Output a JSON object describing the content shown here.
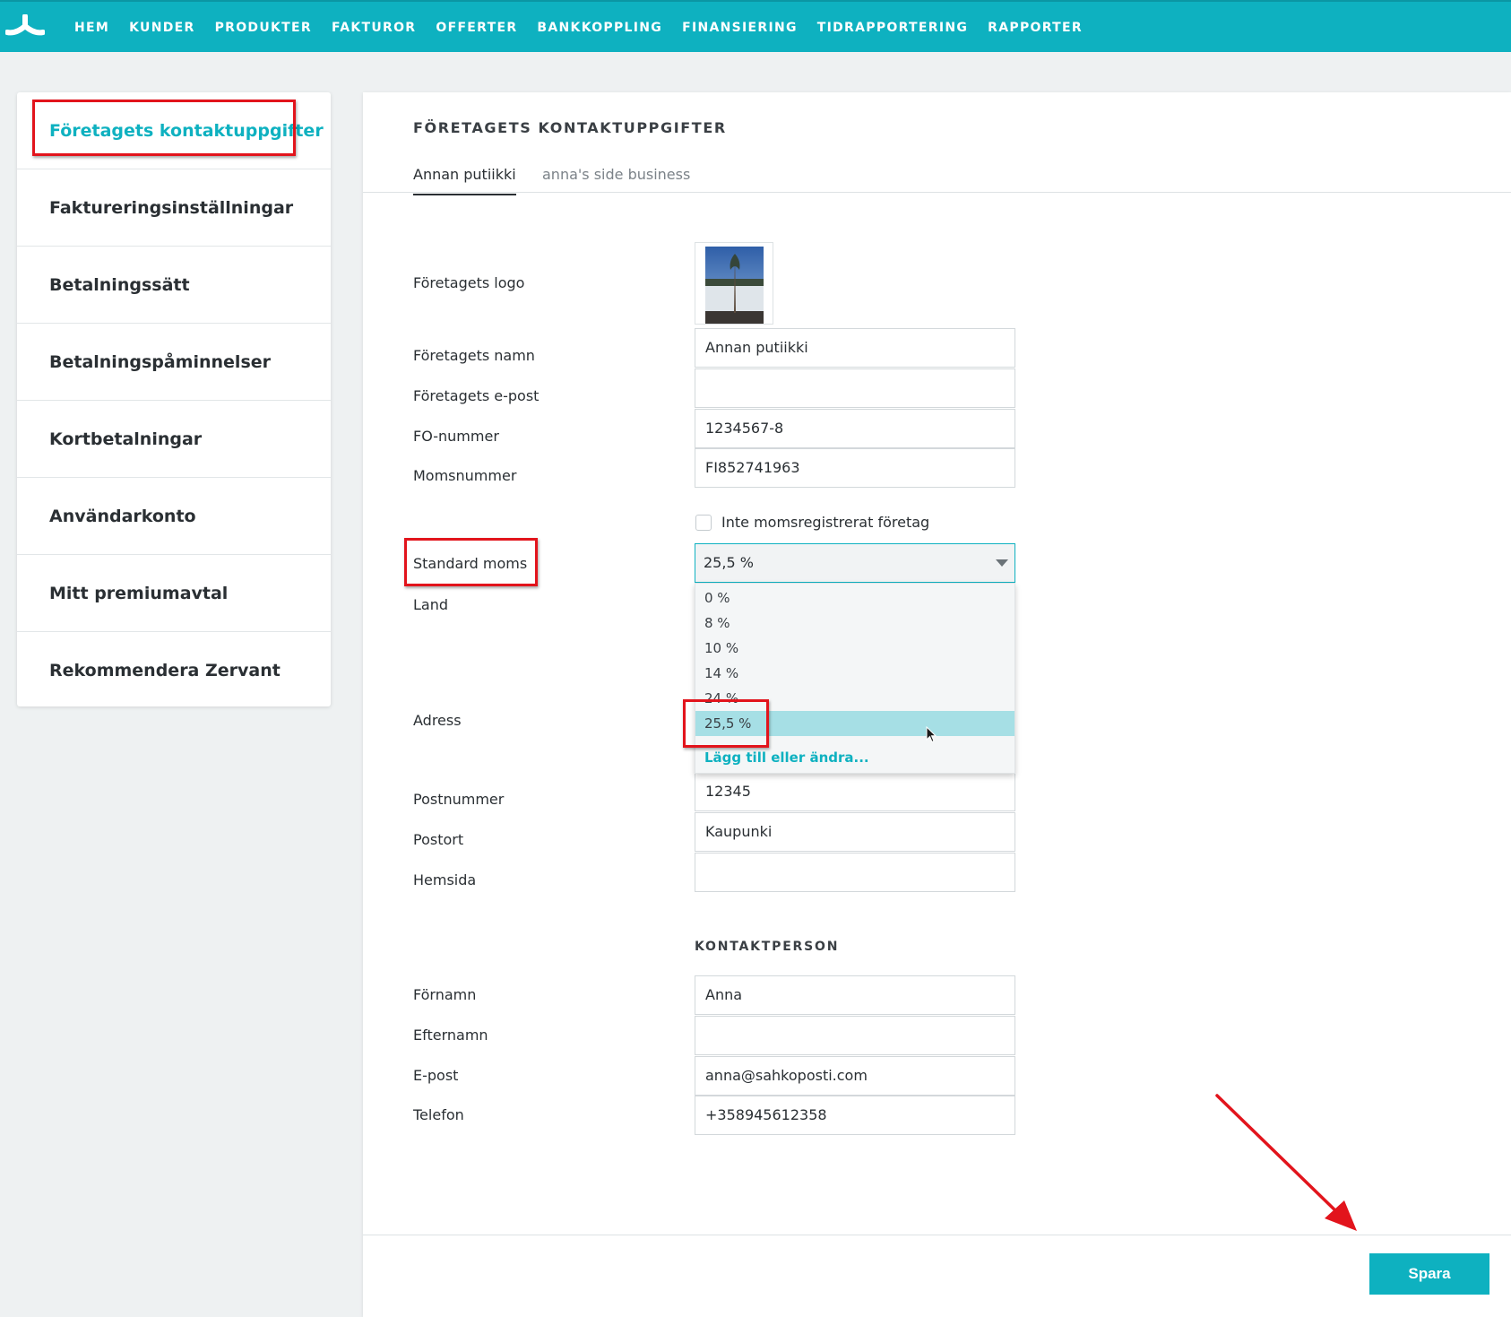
{
  "nav": {
    "items": [
      "HEM",
      "KUNDER",
      "PRODUKTER",
      "FAKTUROR",
      "OFFERTER",
      "BANKKOPPLING",
      "FINANSIERING",
      "TIDRAPPORTERING",
      "RAPPORTER"
    ]
  },
  "sidebar": {
    "items": [
      {
        "label": "Företagets kontaktuppgifter"
      },
      {
        "label": "Faktureringsinställningar"
      },
      {
        "label": "Betalningssätt"
      },
      {
        "label": "Betalningspåminnelser"
      },
      {
        "label": "Kortbetalningar"
      },
      {
        "label": "Användarkonto"
      },
      {
        "label": "Mitt premiumavtal"
      },
      {
        "label": "Rekommendera Zervant"
      }
    ]
  },
  "main": {
    "title": "FÖRETAGETS KONTAKTUPPGIFTER",
    "tabs": [
      {
        "label": "Annan putiikki"
      },
      {
        "label": "anna's side business"
      }
    ]
  },
  "form": {
    "logo_label": "Företagets logo",
    "company_name": {
      "label": "Företagets namn",
      "value": "Annan putiikki"
    },
    "company_email": {
      "label": "Företagets e-post",
      "value": ""
    },
    "fo_number": {
      "label": "FO-nummer",
      "value": "1234567-8"
    },
    "vat_number": {
      "label": "Momsnummer",
      "value": "FI852741963"
    },
    "not_vat_registered": {
      "label": "Inte momsregistrerat företag",
      "checked": false
    },
    "default_vat": {
      "label": "Standard moms",
      "value": "25,5 %",
      "options": [
        "0 %",
        "8 %",
        "10 %",
        "14 %",
        "24 %",
        "25,5 %"
      ],
      "add_or_edit": "Lägg till eller ändra..."
    },
    "country": {
      "label": "Land"
    },
    "address": {
      "label": "Adress"
    },
    "postal_code": {
      "label": "Postnummer",
      "value": "12345"
    },
    "city": {
      "label": "Postort",
      "value": "Kaupunki"
    },
    "website": {
      "label": "Hemsida",
      "value": ""
    }
  },
  "contact": {
    "heading": "KONTAKTPERSON",
    "first_name": {
      "label": "Förnamn",
      "value": "Anna"
    },
    "last_name": {
      "label": "Efternamn",
      "value": ""
    },
    "email": {
      "label": "E-post",
      "value": "anna@sahkoposti.com"
    },
    "phone": {
      "label": "Telefon",
      "value": "+358945612358"
    }
  },
  "footer": {
    "save_label": "Spara"
  },
  "colors": {
    "accent": "#0eb1c0",
    "highlight": "#e2141c",
    "selected_option": "#a6dfe5"
  }
}
